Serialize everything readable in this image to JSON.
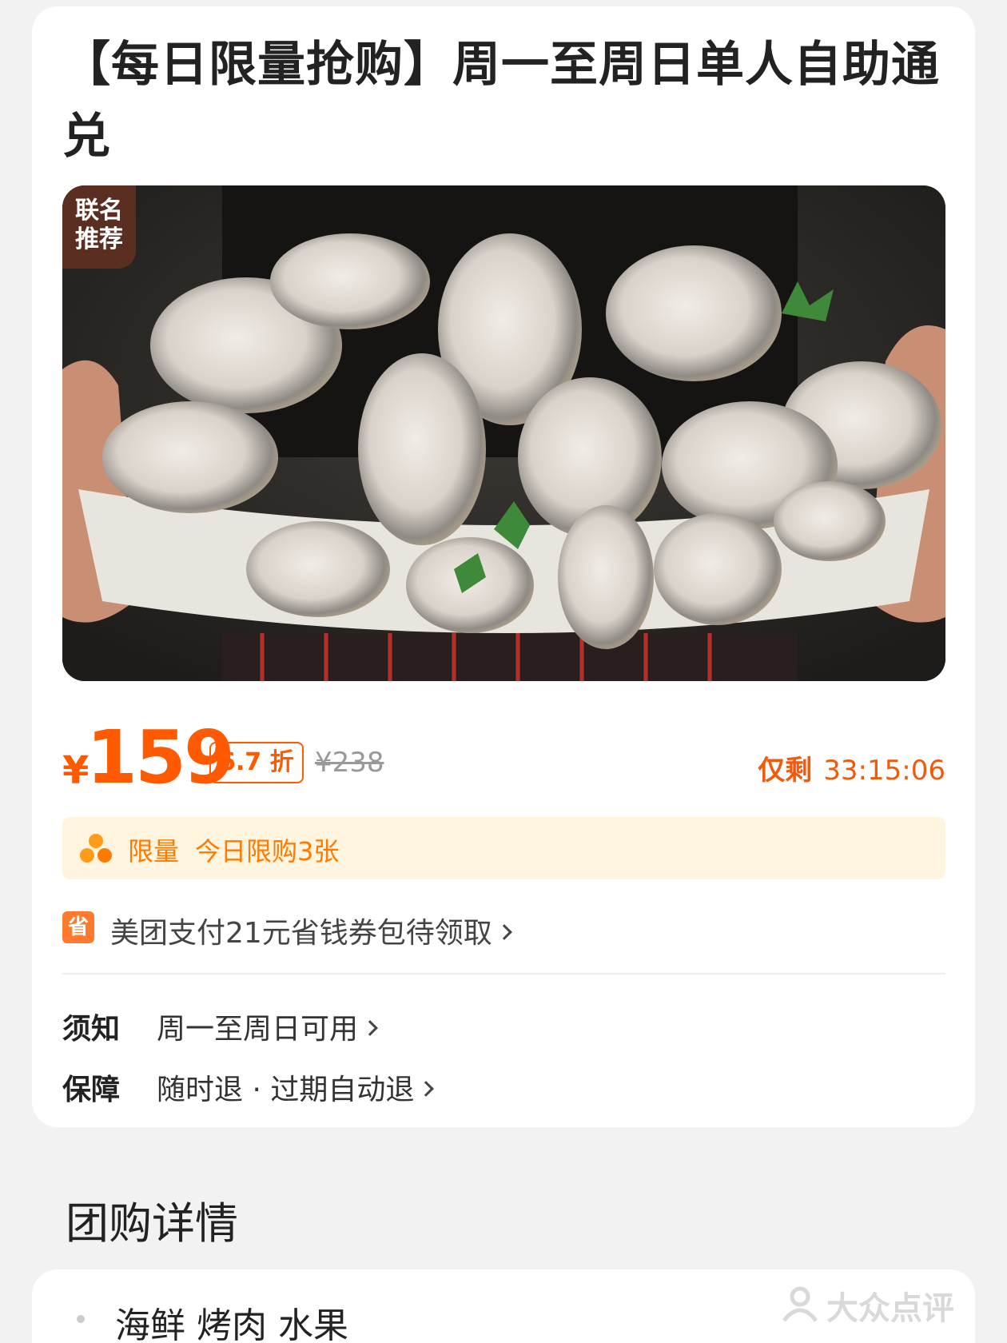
{
  "deal": {
    "title": "【每日限量抢购】周一至周日单人自助通兑",
    "badge_line1": "联名",
    "badge_line2": "推荐",
    "image_icon": "oysters-photo"
  },
  "price": {
    "currency": "¥",
    "amount": "159",
    "discount": "6.7 折",
    "original": "¥238",
    "remaining_label": "仅剩",
    "remaining_time": "33:15:06",
    "accent_color": "#ff5a00"
  },
  "limit": {
    "icon": "limited-icon",
    "tag": "限量",
    "text": "今日限购3张"
  },
  "coupon": {
    "icon_text": "省",
    "text": "美团支付21元省钱券包待领取"
  },
  "notice": {
    "label": "须知",
    "value": "周一至周日可用"
  },
  "guarantee": {
    "label": "保障",
    "value": "随时退 · 过期自动退"
  },
  "details": {
    "section_title": "团购详情",
    "item": "海鲜 烤肉 水果"
  },
  "watermark": {
    "text": "大众点评"
  }
}
